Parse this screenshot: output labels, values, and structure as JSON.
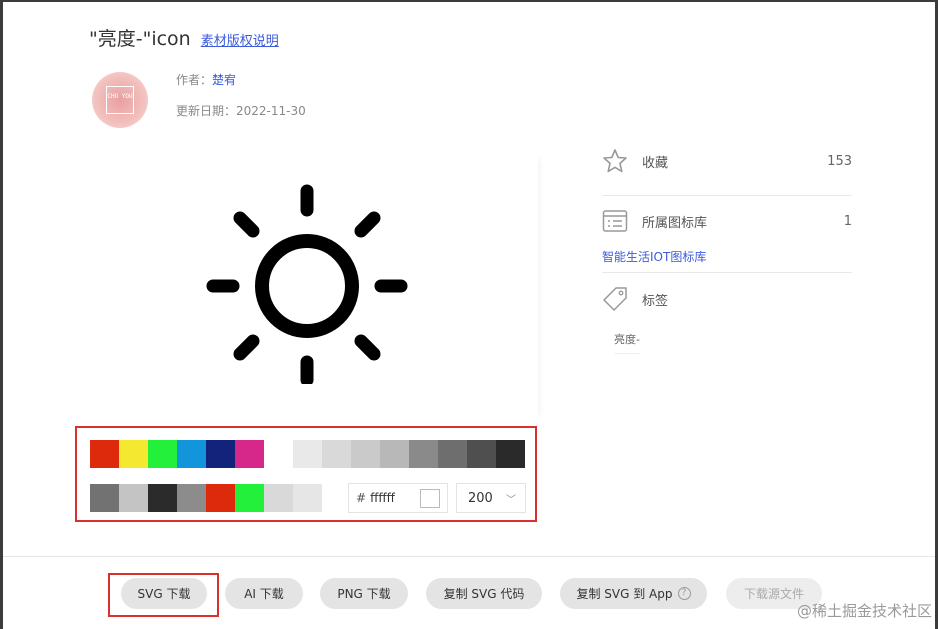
{
  "header": {
    "title": "\"亮度-\"icon",
    "copyright_link": "素材版权说明"
  },
  "author": {
    "label": "作者：",
    "name": "楚宥",
    "avatar_text": "CHU YOU"
  },
  "update": {
    "label": "更新日期：",
    "date": "2022-11-30"
  },
  "palette": {
    "row1": [
      "#dd2a0c",
      "#f4e830",
      "#22f03b",
      "#1295da",
      "#13227a",
      "#d6288a",
      "#ffffff",
      "#e9e9e9",
      "#d9d9d9",
      "#cacaca",
      "#b8b8b8",
      "#8a8a8a",
      "#6e6e6e",
      "#4f4f4f",
      "#2a2a2a"
    ],
    "row2": [
      "#727272",
      "#c4c4c4",
      "#2b2b2b",
      "#8c8c8c",
      "#dd2a0c",
      "#22f03b",
      "#d9d9d9",
      "#e6e6e6"
    ],
    "hex_symbol": "#",
    "hex_value": "ffffff",
    "size_value": "200"
  },
  "sidebar": {
    "favorites_label": "收藏",
    "favorites_count": "153",
    "library_label": "所属图标库",
    "library_count": "1",
    "library_link": "智能生活IOT图标库",
    "tags_label": "标签",
    "tag": "亮度-"
  },
  "actions": {
    "svg_download": "SVG 下载",
    "ai_download": "AI 下载",
    "png_download": "PNG 下载",
    "copy_svg_code": "复制 SVG 代码",
    "copy_svg_app": "复制 SVG 到 App",
    "download_source": "下载源文件"
  },
  "watermark": "@稀土掘金技术社区"
}
